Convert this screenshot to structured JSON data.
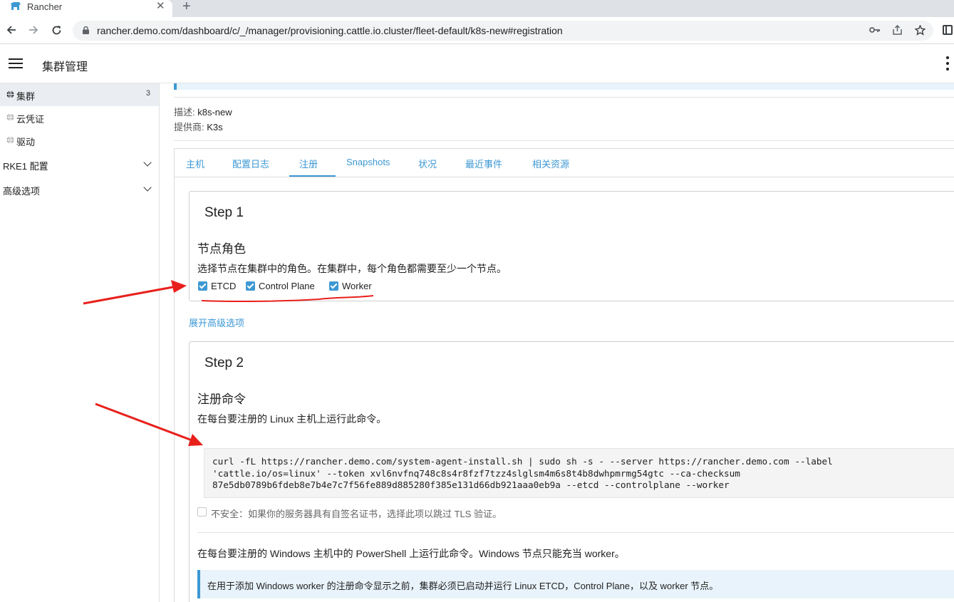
{
  "browser": {
    "tab_title": "Rancher",
    "tab_close": "✕",
    "new_tab": "+",
    "url": "rancher.demo.com/dashboard/c/_/manager/provisioning.cattle.io.cluster/fleet-default/k8s-new#registration",
    "icons": [
      "back-icon",
      "forward-icon",
      "reload-icon",
      "lock-icon",
      "key-icon",
      "share-icon",
      "star-icon",
      "side-panel-icon"
    ]
  },
  "header": {
    "title": "集群管理"
  },
  "sidebar": {
    "items": [
      {
        "label": "集群",
        "count": "3"
      },
      {
        "label": "云凭证"
      },
      {
        "label": "驱动"
      }
    ],
    "groups": [
      {
        "label": "RKE1 配置"
      },
      {
        "label": "高级选项"
      }
    ]
  },
  "detail": {
    "description_key": "描述:",
    "description_value": "k8s-new",
    "provider_key": "提供商:",
    "provider_value": "K3s"
  },
  "tabs": [
    {
      "label": "主机"
    },
    {
      "label": "配置日志"
    },
    {
      "label": "注册",
      "active": true
    },
    {
      "label": "Snapshots"
    },
    {
      "label": "状况"
    },
    {
      "label": "最近事件"
    },
    {
      "label": "相关资源"
    }
  ],
  "step1": {
    "title": "Step 1",
    "section_title": "节点角色",
    "description": "选择节点在集群中的角色。在集群中，每个角色都需要至少一个节点。",
    "roles": [
      {
        "label": "ETCD",
        "checked": true
      },
      {
        "label": "Control Plane",
        "checked": true
      },
      {
        "label": "Worker",
        "checked": true
      }
    ]
  },
  "advanced_link": "展开高级选项",
  "step2": {
    "title": "Step 2",
    "section_title": "注册命令",
    "description": "在每台要注册的 Linux 主机上运行此命令。",
    "command_lines": [
      "curl -fL https://rancher.demo.com/system-agent-install.sh | sudo sh -s - --server https://rancher.demo.com --label",
      "'cattle.io/os=linux' --token xvl6nvfnq748c8s4r8fzf7tzz4slglsm4m6s8t4b8dwhpmrmg54gtc --ca-checksum",
      "87e5db0789b6fdeb8e7b4e7c7f56fe889d885280f385e131d66db921aaa0eb9a --etcd --controlplane --worker"
    ],
    "insecure_label": "不安全：如果你的服务器具有自签名证书，选择此项以跳过 TLS 验证。",
    "windows_description": "在每台要注册的 Windows 主机中的 PowerShell 上运行此命令。Windows 节点只能充当 worker。",
    "windows_info": "在用于添加 Windows worker 的注册命令显示之前，集群必须已启动并运行 Linux ETCD，Control Plane，以及 worker 节点。"
  },
  "colors": {
    "accent": "#3d98d3",
    "annotation": "#e8201c"
  }
}
